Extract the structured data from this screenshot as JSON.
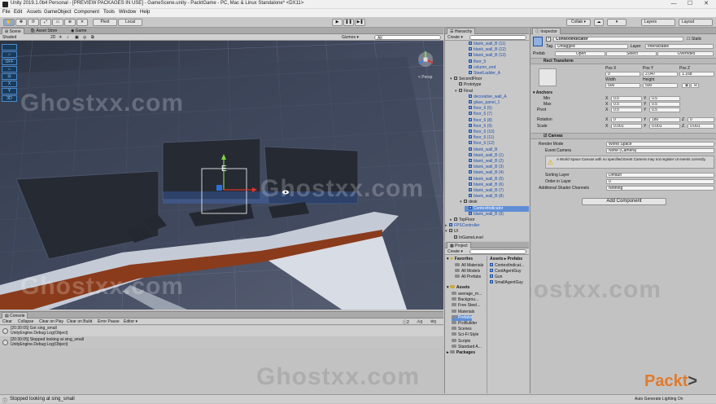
{
  "window": {
    "title": "Unity 2019.1.0b4 Personal - [PREVIEW PACKAGES IN USE] - GameScene.unity - PacktGame - PC, Mac & Linux Standalone* <DX11>",
    "minimize": "—",
    "maximize": "☐",
    "close": "✕"
  },
  "menu": [
    "File",
    "Edit",
    "Assets",
    "GameObject",
    "Component",
    "Tools",
    "Window",
    "Help"
  ],
  "toolbar": {
    "pivot": "Pivot",
    "local": "Local",
    "collab": "Collab ▾",
    "layers": "Layers",
    "layout": "Layout"
  },
  "scene": {
    "tabs": [
      "Scene",
      "Asset Store",
      "Game"
    ],
    "shading": "Shaded",
    "mode_2d": "2D",
    "gizmos": "Gizmos ▾",
    "search_placeholder": "All",
    "persp": "< Persp",
    "object_label": "E",
    "overlay_toggles": [
      "",
      "",
      "OFF",
      "",
      "",
      "X",
      "Y",
      "3D"
    ]
  },
  "watermark": "Ghostxx.com",
  "console": {
    "tab": "Console",
    "buttons": [
      "Clear",
      "Collapse",
      "Clear on Play",
      "Clear on Build",
      "Error Pause",
      "Editor ▾"
    ],
    "counts": [
      "2",
      "0",
      "0"
    ],
    "entries": [
      {
        "line1": "[20:30:05] Got sing_small",
        "line2": "UnityEngine.Debug:Log(Object)"
      },
      {
        "line1": "[20:30:05] Stopped looking at sing_small",
        "line2": "UnityEngine.Debug:Log(Object)"
      }
    ]
  },
  "hierarchy": {
    "tab": "Hierarchy",
    "create": "Create ▾",
    "items": [
      {
        "label": "blank_wall_B (11)",
        "indent": 6,
        "style": "blue"
      },
      {
        "label": "blank_wall_B (12)",
        "indent": 6,
        "style": "blue"
      },
      {
        "label": "blank_wall_B (13)",
        "indent": 6,
        "style": "blue"
      },
      {
        "label": "floor_5",
        "indent": 6,
        "style": "blue"
      },
      {
        "label": "column_end",
        "indent": 6,
        "style": "blue"
      },
      {
        "label": "SteelLadder_A",
        "indent": 6,
        "style": "blue"
      },
      {
        "label": "SecondFloor",
        "indent": 3,
        "style": "plain",
        "arrow": "▾"
      },
      {
        "label": "Prototype",
        "indent": 4,
        "style": "plain"
      },
      {
        "label": "Final",
        "indent": 4,
        "style": "plain",
        "arrow": "▾"
      },
      {
        "label": "decorative_wall_A",
        "indent": 6,
        "style": "blue"
      },
      {
        "label": "glass_panel_1",
        "indent": 6,
        "style": "blue"
      },
      {
        "label": "floor_6 (5)",
        "indent": 6,
        "style": "blue"
      },
      {
        "label": "floor_6 (7)",
        "indent": 6,
        "style": "blue"
      },
      {
        "label": "floor_6 (8)",
        "indent": 6,
        "style": "blue"
      },
      {
        "label": "floor_6 (9)",
        "indent": 6,
        "style": "blue"
      },
      {
        "label": "floor_6 (10)",
        "indent": 6,
        "style": "blue"
      },
      {
        "label": "floor_6 (11)",
        "indent": 6,
        "style": "blue"
      },
      {
        "label": "floor_6 (12)",
        "indent": 6,
        "style": "blue"
      },
      {
        "label": "blank_wall_B",
        "indent": 6,
        "style": "blue"
      },
      {
        "label": "blank_wall_B (1)",
        "indent": 6,
        "style": "blue"
      },
      {
        "label": "blank_wall_B (2)",
        "indent": 6,
        "style": "blue"
      },
      {
        "label": "blank_wall_B (3)",
        "indent": 6,
        "style": "blue"
      },
      {
        "label": "blank_wall_B (4)",
        "indent": 6,
        "style": "blue"
      },
      {
        "label": "blank_wall_B (5)",
        "indent": 6,
        "style": "blue"
      },
      {
        "label": "blank_wall_B (6)",
        "indent": 6,
        "style": "blue"
      },
      {
        "label": "blank_wall_B (7)",
        "indent": 6,
        "style": "blue"
      },
      {
        "label": "blank_wall_B (8)",
        "indent": 6,
        "style": "blue"
      },
      {
        "label": "desk",
        "indent": 5,
        "style": "plain",
        "arrow": "▾"
      },
      {
        "label": "ContextIndicator",
        "indent": 6,
        "style": "selected"
      },
      {
        "label": "blank_wall_B (9)",
        "indent": 6,
        "style": "blue"
      },
      {
        "label": "TopFloor",
        "indent": 3,
        "style": "plain",
        "arrow": "▸"
      },
      {
        "label": "FPSController",
        "indent": 2,
        "style": "blue",
        "arrow": "▸"
      },
      {
        "label": "UI",
        "indent": 2,
        "style": "plain",
        "arrow": "▾"
      },
      {
        "label": "InGameLevel",
        "indent": 3,
        "style": "plain"
      }
    ]
  },
  "project": {
    "tab": "Project",
    "create": "Create ▾",
    "favorites": {
      "label": "Favorites",
      "items": [
        "All Materials",
        "All Models",
        "All Prefabs"
      ]
    },
    "assets": {
      "label": "Assets",
      "items": [
        "average_m...",
        "Backgrou...",
        "Free Steel...",
        "Materials",
        "Prefabs",
        "ProBuilder",
        "Scenes",
        "Sci-Fi Style",
        "Scripts",
        "Standard A..."
      ]
    },
    "packages": "Packages",
    "breadcrumb": "Assets ▸ Prefabs",
    "prefabs": [
      "ContextIndicat...",
      "CoolAgentGuy",
      "Gun",
      "SmallAgentGuy"
    ]
  },
  "inspector": {
    "tab": "Inspector",
    "object_name": "ContextIndicator",
    "static": "Static",
    "tag_label": "Tag",
    "tag_value": "Untagged",
    "layer_label": "Layer",
    "layer_value": "Interactable",
    "prefab_label": "Prefab",
    "prefab_buttons": [
      "Open",
      "Select",
      "Overrides"
    ],
    "rect_transform": "Rect Transform",
    "pos_headers": [
      "Pos X",
      "Pos Y",
      "Pos Z"
    ],
    "pos_values": [
      "0",
      "2.047",
      "1.168"
    ],
    "size_headers": [
      "Width",
      "Height"
    ],
    "size_values": [
      "500",
      "500"
    ],
    "anchors": "Anchors",
    "min_label": "Min",
    "min": [
      "0.5",
      "0.5"
    ],
    "max_label": "Max",
    "max": [
      "0.5",
      "0.5"
    ],
    "pivot_label": "Pivot",
    "pivot": [
      "0.5",
      "0.5"
    ],
    "rotation_label": "Rotation",
    "rotation": [
      "0",
      "180",
      "0"
    ],
    "scale_label": "Scale",
    "scale": [
      "0.001",
      "0.001",
      "0.001"
    ],
    "xyz": [
      "X",
      "Y",
      "Z"
    ],
    "r_button": "R",
    "canvas": "Canvas",
    "render_mode_label": "Render Mode",
    "render_mode": "World Space",
    "event_camera_label": "Event Camera",
    "event_camera": "None (Camera)",
    "warning": "A World Space Canvas with no specified Event Camera may not register UI events correctly.",
    "sorting_layer_label": "Sorting Layer",
    "sorting_layer": "Default",
    "order_label": "Order in Layer",
    "order": "0",
    "shader_label": "Additional Shader Channels",
    "shader": "Nothing",
    "add_component": "Add Component",
    "brand": "Packt",
    "brand_arrow": ">"
  },
  "status": {
    "left": "Stopped looking at sing_small",
    "right": "Auto Generate Lighting On"
  }
}
